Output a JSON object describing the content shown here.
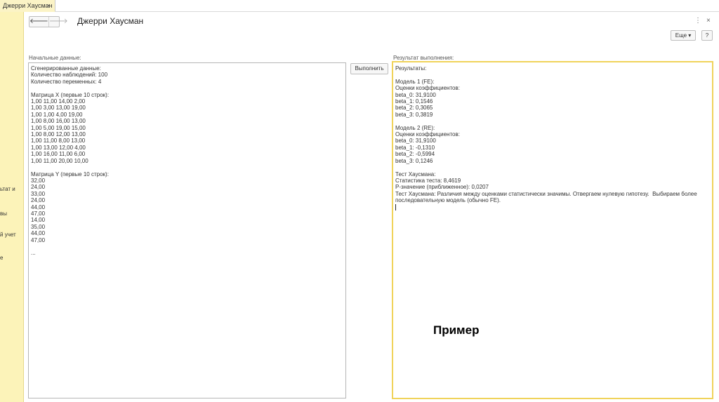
{
  "tabstrip": {
    "tab_title": "Джерри Хаусман",
    "close": "×"
  },
  "left_panel": {
    "fragments": [
      "ьтат и",
      "вы",
      "й учет",
      "е"
    ]
  },
  "header": {
    "title": "Джерри Хаусман",
    "back": "🡐",
    "forward": "🡒",
    "menu_dots": "⋮",
    "close": "×",
    "more_label": "Еще ▾",
    "help_label": "?"
  },
  "input": {
    "label": "Начальные данные:",
    "lines": [
      "Сгенерированные данные:",
      "Количество наблюдений: 100",
      "Количество переменных: 4",
      "",
      "Матрица X (первые 10 строк):",
      "1,00 11,00 14,00 2,00",
      "1,00 3,00 13,00 19,00",
      "1,00 1,00 4,00 19,00",
      "1,00 8,00 16,00 13,00",
      "1,00 5,00 19,00 15,00",
      "1,00 8,00 12,00 13,00",
      "1,00 11,00 8,00 13,00",
      "1,00 13,00 12,00 4,00",
      "1,00 16,00 11,00 6,00",
      "1,00 11,00 20,00 10,00",
      "",
      "Матрица Y (первые 10 строк):",
      "32,00",
      "24,00",
      "33,00",
      "24,00",
      "44,00",
      "47,00",
      "14,00",
      "35,00",
      "44,00",
      "47,00",
      "",
      "..."
    ]
  },
  "run_button": {
    "label": "Выполнить"
  },
  "output": {
    "label": "Результат выполнения:",
    "lines": [
      "Результаты:",
      "",
      "Модель 1 (FE):",
      "Оценки коэффициентов:",
      "beta_0: 31,9100",
      "beta_1: 0,1546",
      "beta_2: 0,3065",
      "beta_3: 0,3819",
      "",
      "Модель 2 (RE):",
      "Оценки коэффициентов:",
      "beta_0: 31,9100",
      "beta_1: -0,1310",
      "beta_2: -0,5994",
      "beta_3: 0,1246",
      "",
      "Тест Хаусмана:",
      "Статистика теста: 8,4619",
      "P-значение (приближенное): 0,0207",
      "Тест Хаусмана: Различия между оценками статистически значимы. Отвергаем нулевую гипотезу.  Выбираем более",
      "последовательную модель (обычно FE)."
    ]
  },
  "overlay_text": "Пример",
  "colors": {
    "accent_yellow": "#f0d35a",
    "panel_yellow": "#fcf3b9"
  }
}
